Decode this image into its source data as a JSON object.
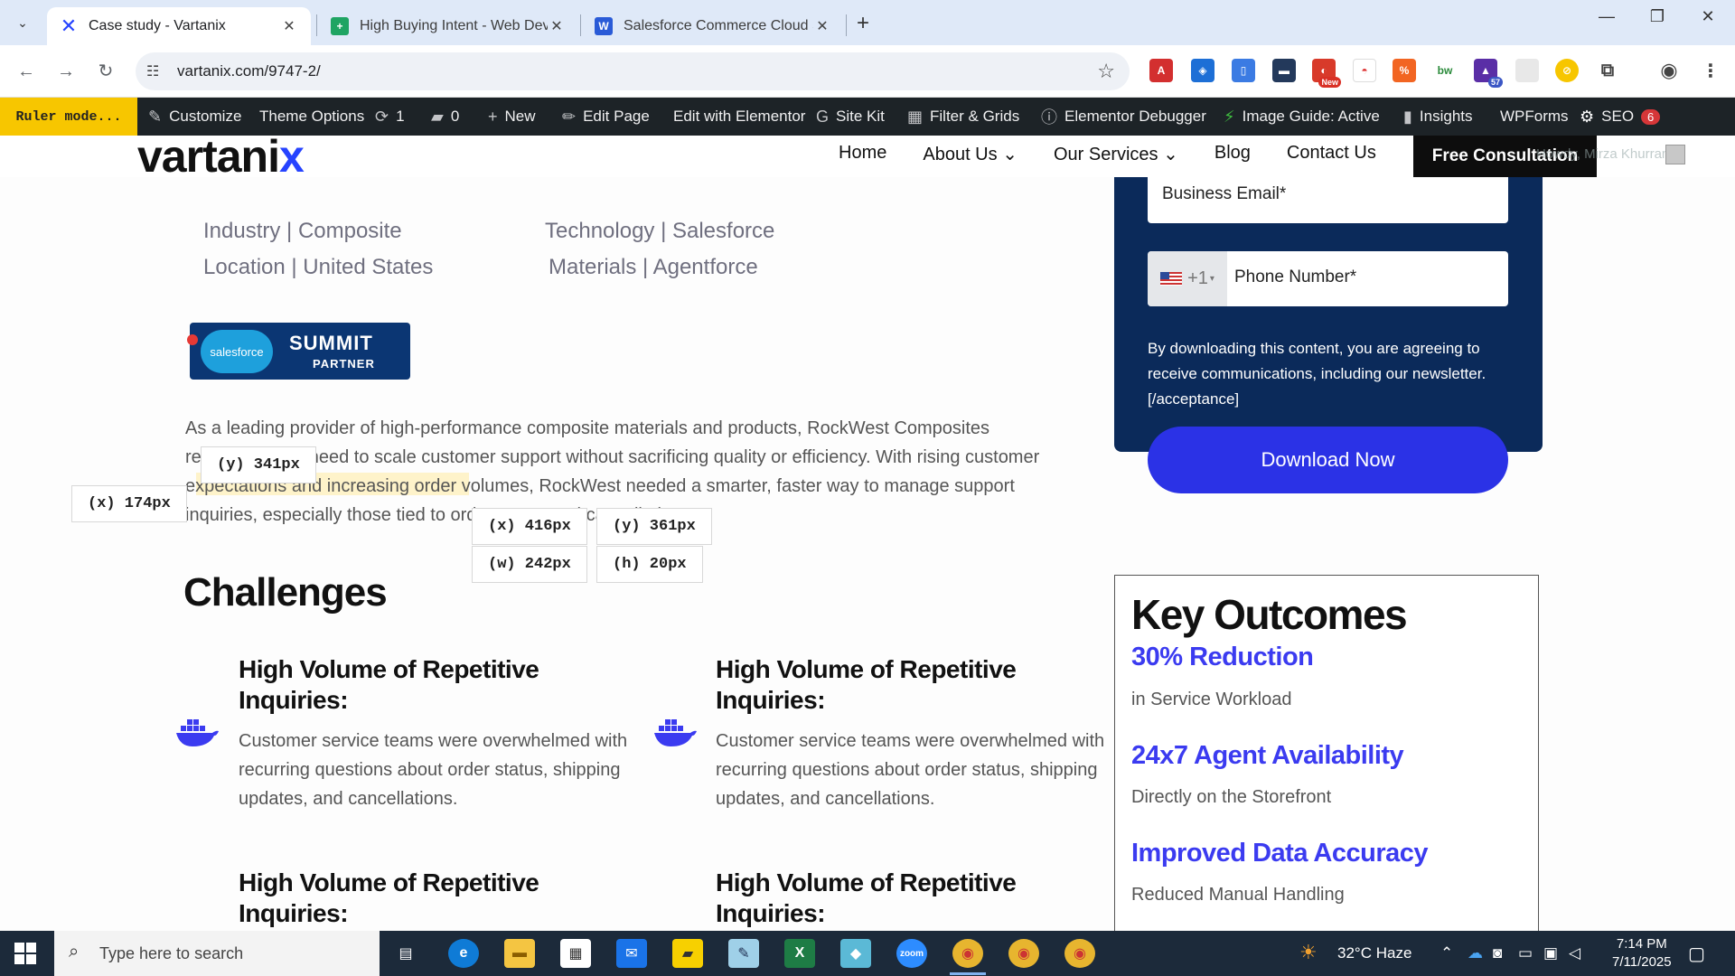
{
  "browser": {
    "tabs": [
      {
        "title": "Case study - Vartanix",
        "active": true
      },
      {
        "title": "High Buying Intent - Web Deve",
        "active": false
      },
      {
        "title": "Salesforce Commerce Cloud Su",
        "active": false
      }
    ],
    "url": "vartanix.com/9747-2/",
    "extensions": {
      "new_badge": "New",
      "count_badge": "57"
    }
  },
  "adminbar": {
    "ruler_mode": "Ruler mode...",
    "customize": "Customize",
    "theme_options": "Theme Options",
    "updates_count": "1",
    "comments_count": "0",
    "new": "New",
    "edit_page": "Edit Page",
    "edit_elementor": "Edit with Elementor",
    "site_kit": "Site Kit",
    "filter_grids": "Filter & Grids",
    "elementor_debugger": "Elementor Debugger",
    "image_guide": "Image Guide: Active",
    "insights": "Insights",
    "wpforms": "WPForms",
    "seo": "SEO",
    "seo_count": "6"
  },
  "header": {
    "logo_main": "vartani",
    "logo_accent": "x",
    "nav": [
      "Home",
      "About Us",
      "Our Services",
      "Blog",
      "Contact Us"
    ],
    "cta": "Free Consultation",
    "howdy": "Howdy, Mirza Khurram"
  },
  "meta": {
    "industry": "Industry | Composite",
    "location": "Location | United States",
    "technology": "Technology | Salesforce",
    "materials": "Materials | Agentforce"
  },
  "badge": {
    "brand": "salesforce",
    "line1": "SUMMIT",
    "line2": "PARTNER"
  },
  "intro": "As a leading provider of high-performance composite materials and products, RockWest Composites recognized the need to scale customer support without sacrificing quality or efficiency. With rising customer expectations and increasing order volumes, RockWest needed a smarter, faster way to manage support inquiries, especially those tied to order status and cancellations.",
  "ruler": {
    "y_top": "(y) 341px",
    "x_left": "(x) 174px",
    "x_sel": "(x) 416px",
    "y_sel": "(y) 361px",
    "w_sel": "(w) 242px",
    "h_sel": "(h) 20px"
  },
  "challenges": {
    "heading": "Challenges",
    "cards": [
      {
        "title": "High Volume of Repetitive Inquiries:",
        "body": "Customer service teams were overwhelmed with recurring questions about order status, shipping updates, and cancellations."
      },
      {
        "title": "High Volume of Repetitive Inquiries:",
        "body": "Customer service teams were overwhelmed with recurring questions about order status, shipping updates, and cancellations."
      },
      {
        "title": "High Volume of Repetitive Inquiries:",
        "body": ""
      },
      {
        "title": "High Volume of Repetitive Inquiries:",
        "body": ""
      }
    ]
  },
  "form": {
    "email_placeholder": "Business Email*",
    "phone_code": "+1",
    "phone_placeholder": "Phone Number*",
    "consent": "By downloading this content, you are agreeing to receive communications, including our newsletter. [/acceptance]",
    "download": "Download Now"
  },
  "outcomes": {
    "title": "Key Outcomes",
    "items": [
      {
        "stat": "30% Reduction",
        "sub": "in Service Workload"
      },
      {
        "stat": "24x7 Agent Availability",
        "sub": "Directly on the Storefront"
      },
      {
        "stat": "Improved Data Accuracy",
        "sub": "Reduced Manual Handling"
      }
    ]
  },
  "taskbar": {
    "search_placeholder": "Type here to search",
    "weather": "32°C  Haze",
    "time": "7:14 PM",
    "date": "7/11/2025"
  },
  "colors": {
    "accent": "#2b32e6",
    "form_bg": "#0b2a5a",
    "adminbar_bg": "#1d2327",
    "ruler_yellow": "#f7c600"
  }
}
